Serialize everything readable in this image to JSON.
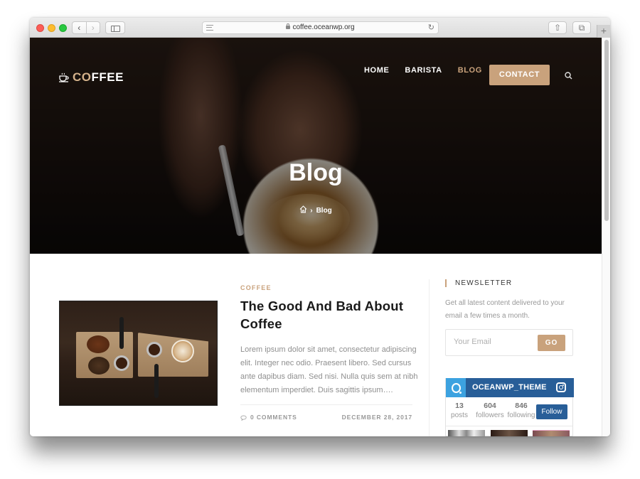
{
  "browser": {
    "url": "coffee.oceanwp.org",
    "back_glyph": "‹",
    "forward_glyph": "›",
    "reload_glyph": "↻",
    "share_glyph": "⇧",
    "tabs_glyph": "⧉",
    "new_tab_glyph": "+",
    "icons": [
      "close-window",
      "minimize-window",
      "zoom-window",
      "back-arrow",
      "forward-arrow",
      "sidebar",
      "reader-mode",
      "lock",
      "reload",
      "share",
      "tabs-overview",
      "new-tab"
    ]
  },
  "site": {
    "logo": {
      "prefix": "CO",
      "suffix": "FFEE",
      "icon": "coffee-cup-icon"
    },
    "nav": [
      {
        "label": "HOME",
        "active": false
      },
      {
        "label": "BARISTA",
        "active": false
      },
      {
        "label": "BLOG",
        "active": true
      }
    ],
    "contact_label": "CONTACT",
    "search_icon": "search-icon",
    "colors": {
      "accent": "#c9a27c",
      "instagram_header": "#285e98",
      "instagram_logo": "#3ca2e0",
      "title": "#1a1a1a",
      "muted": "#999999"
    }
  },
  "hero": {
    "title": "Blog",
    "breadcrumb": {
      "home_icon": "home-icon",
      "separator": "›",
      "current": "Blog"
    }
  },
  "post": {
    "category": "COFFEE",
    "title": "The Good And Bad About Coffee",
    "excerpt": "Lorem ipsum dolor sit amet, consectetur adipiscing elit. Integer nec odio. Praesent libero. Sed cursus ante dapibus diam. Sed nisi. Nulla quis sem at nibh elementum imperdiet. Duis sagittis ipsum….",
    "comments": "0 COMMENTS",
    "date": "DECEMBER 28, 2017",
    "image_alt": "Coffee grounds, beans, portafilters and latte on wooden boards"
  },
  "sidebar": {
    "newsletter": {
      "title": "NEWSLETTER",
      "text": "Get all latest content delivered to your email a few times a month.",
      "email_placeholder": "Your Email",
      "email_value": "",
      "button_label": "GO"
    },
    "instagram": {
      "username": "OCEANWP_THEME",
      "stats": [
        {
          "value": "13",
          "label": "posts"
        },
        {
          "value": "604",
          "label": "followers"
        },
        {
          "value": "846",
          "label": "following"
        }
      ],
      "follow_label": "Follow"
    }
  }
}
